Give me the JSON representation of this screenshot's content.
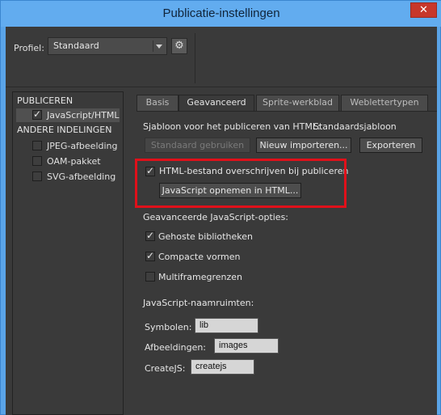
{
  "window": {
    "title": "Publicatie-instellingen",
    "close_glyph": "✕"
  },
  "profile": {
    "label": "Profiel:",
    "value": "Standaard",
    "gear_glyph": "⚙"
  },
  "sidebar": {
    "publish_header": "PUBLICEREN",
    "publish_items": [
      {
        "label": "JavaScript/HTML",
        "checked": true
      }
    ],
    "other_header": "ANDERE INDELINGEN",
    "other_items": [
      {
        "label": "JPEG-afbeelding",
        "checked": false
      },
      {
        "label": "OAM-pakket",
        "checked": false
      },
      {
        "label": "SVG-afbeelding",
        "checked": false
      }
    ]
  },
  "tabs": [
    "Basis",
    "Geavanceerd",
    "Sprite-werkblad",
    "Weblettertypen"
  ],
  "active_tab": "Geavanceerd",
  "template": {
    "label": "Sjabloon voor het publiceren van HTML:",
    "value": "Standaardsjabloon",
    "use_default": "Standaard gebruiken",
    "import_new": "Nieuw importeren...",
    "export": "Exporteren"
  },
  "overwrite": {
    "label": "HTML-bestand overschrijven bij publiceren",
    "checked": true
  },
  "include_js_button": "JavaScript opnemen in HTML...",
  "advanced_js": {
    "header": "Geavanceerde JavaScript-opties:",
    "options": [
      {
        "label": "Gehoste bibliotheken",
        "checked": true
      },
      {
        "label": "Compacte vormen",
        "checked": true
      },
      {
        "label": "Multiframegrenzen",
        "checked": false
      }
    ]
  },
  "namespaces": {
    "header": "JavaScript-naamruimten:",
    "symbols_label": "Symbolen:",
    "symbols_value": "lib",
    "images_label": "Afbeeldingen:",
    "images_value": "images",
    "createjs_label": "CreateJS:",
    "createjs_value": "createjs"
  },
  "colors": {
    "highlight": "#e0101a",
    "dialog_bg": "#3a3a3a",
    "titlebar": "#62acef"
  }
}
